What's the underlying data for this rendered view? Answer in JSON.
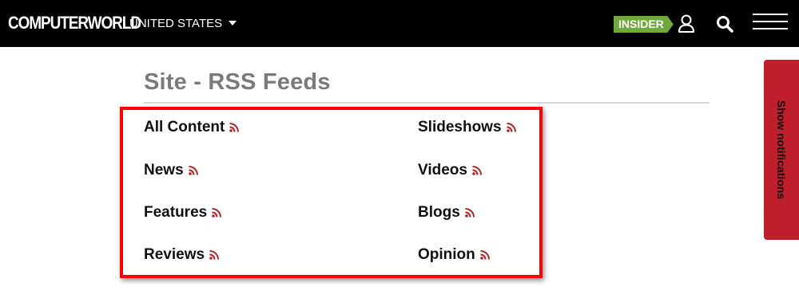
{
  "header": {
    "logo_text": "COMPUTERWORLD",
    "region_label": "UNITED STATES",
    "insider_label": "INSIDER",
    "icons": {
      "user": "user-icon",
      "search": "search-icon",
      "menu": "hamburger-menu-icon",
      "region_caret": "caret-down-icon"
    }
  },
  "main": {
    "title": "Site - RSS Feeds",
    "feeds_left": [
      "All Content",
      "News",
      "Features",
      "Reviews"
    ],
    "feeds_right": [
      "Slideshows",
      "Videos",
      "Blogs",
      "Opinion"
    ],
    "feed_icon": "rss-icon"
  },
  "notifications_tab": {
    "label": "Show notifications"
  },
  "colors": {
    "header_bg": "#000000",
    "insider_green": "#6fa83b",
    "rss_red": "#b22222",
    "highlight_red": "#ff0000",
    "notif_red": "#bf1e2d",
    "title_gray": "#7a7a7a"
  }
}
